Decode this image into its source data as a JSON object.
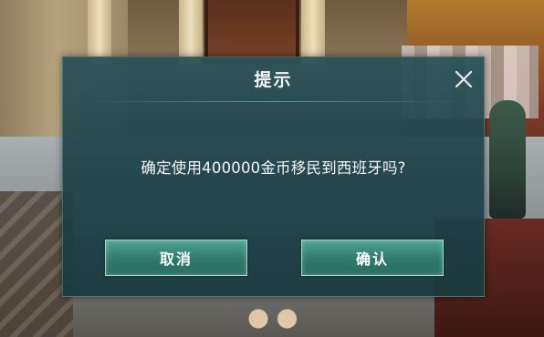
{
  "dialog": {
    "title": "提示",
    "message": "确定使用400000金币移民到西班牙吗?",
    "cancel_label": "取消",
    "confirm_label": "确认",
    "close_icon": "close-icon"
  },
  "colors": {
    "dialog_bg": "#1e4248",
    "button_bg": "#2f7a6b",
    "text": "#f4f6f4"
  }
}
